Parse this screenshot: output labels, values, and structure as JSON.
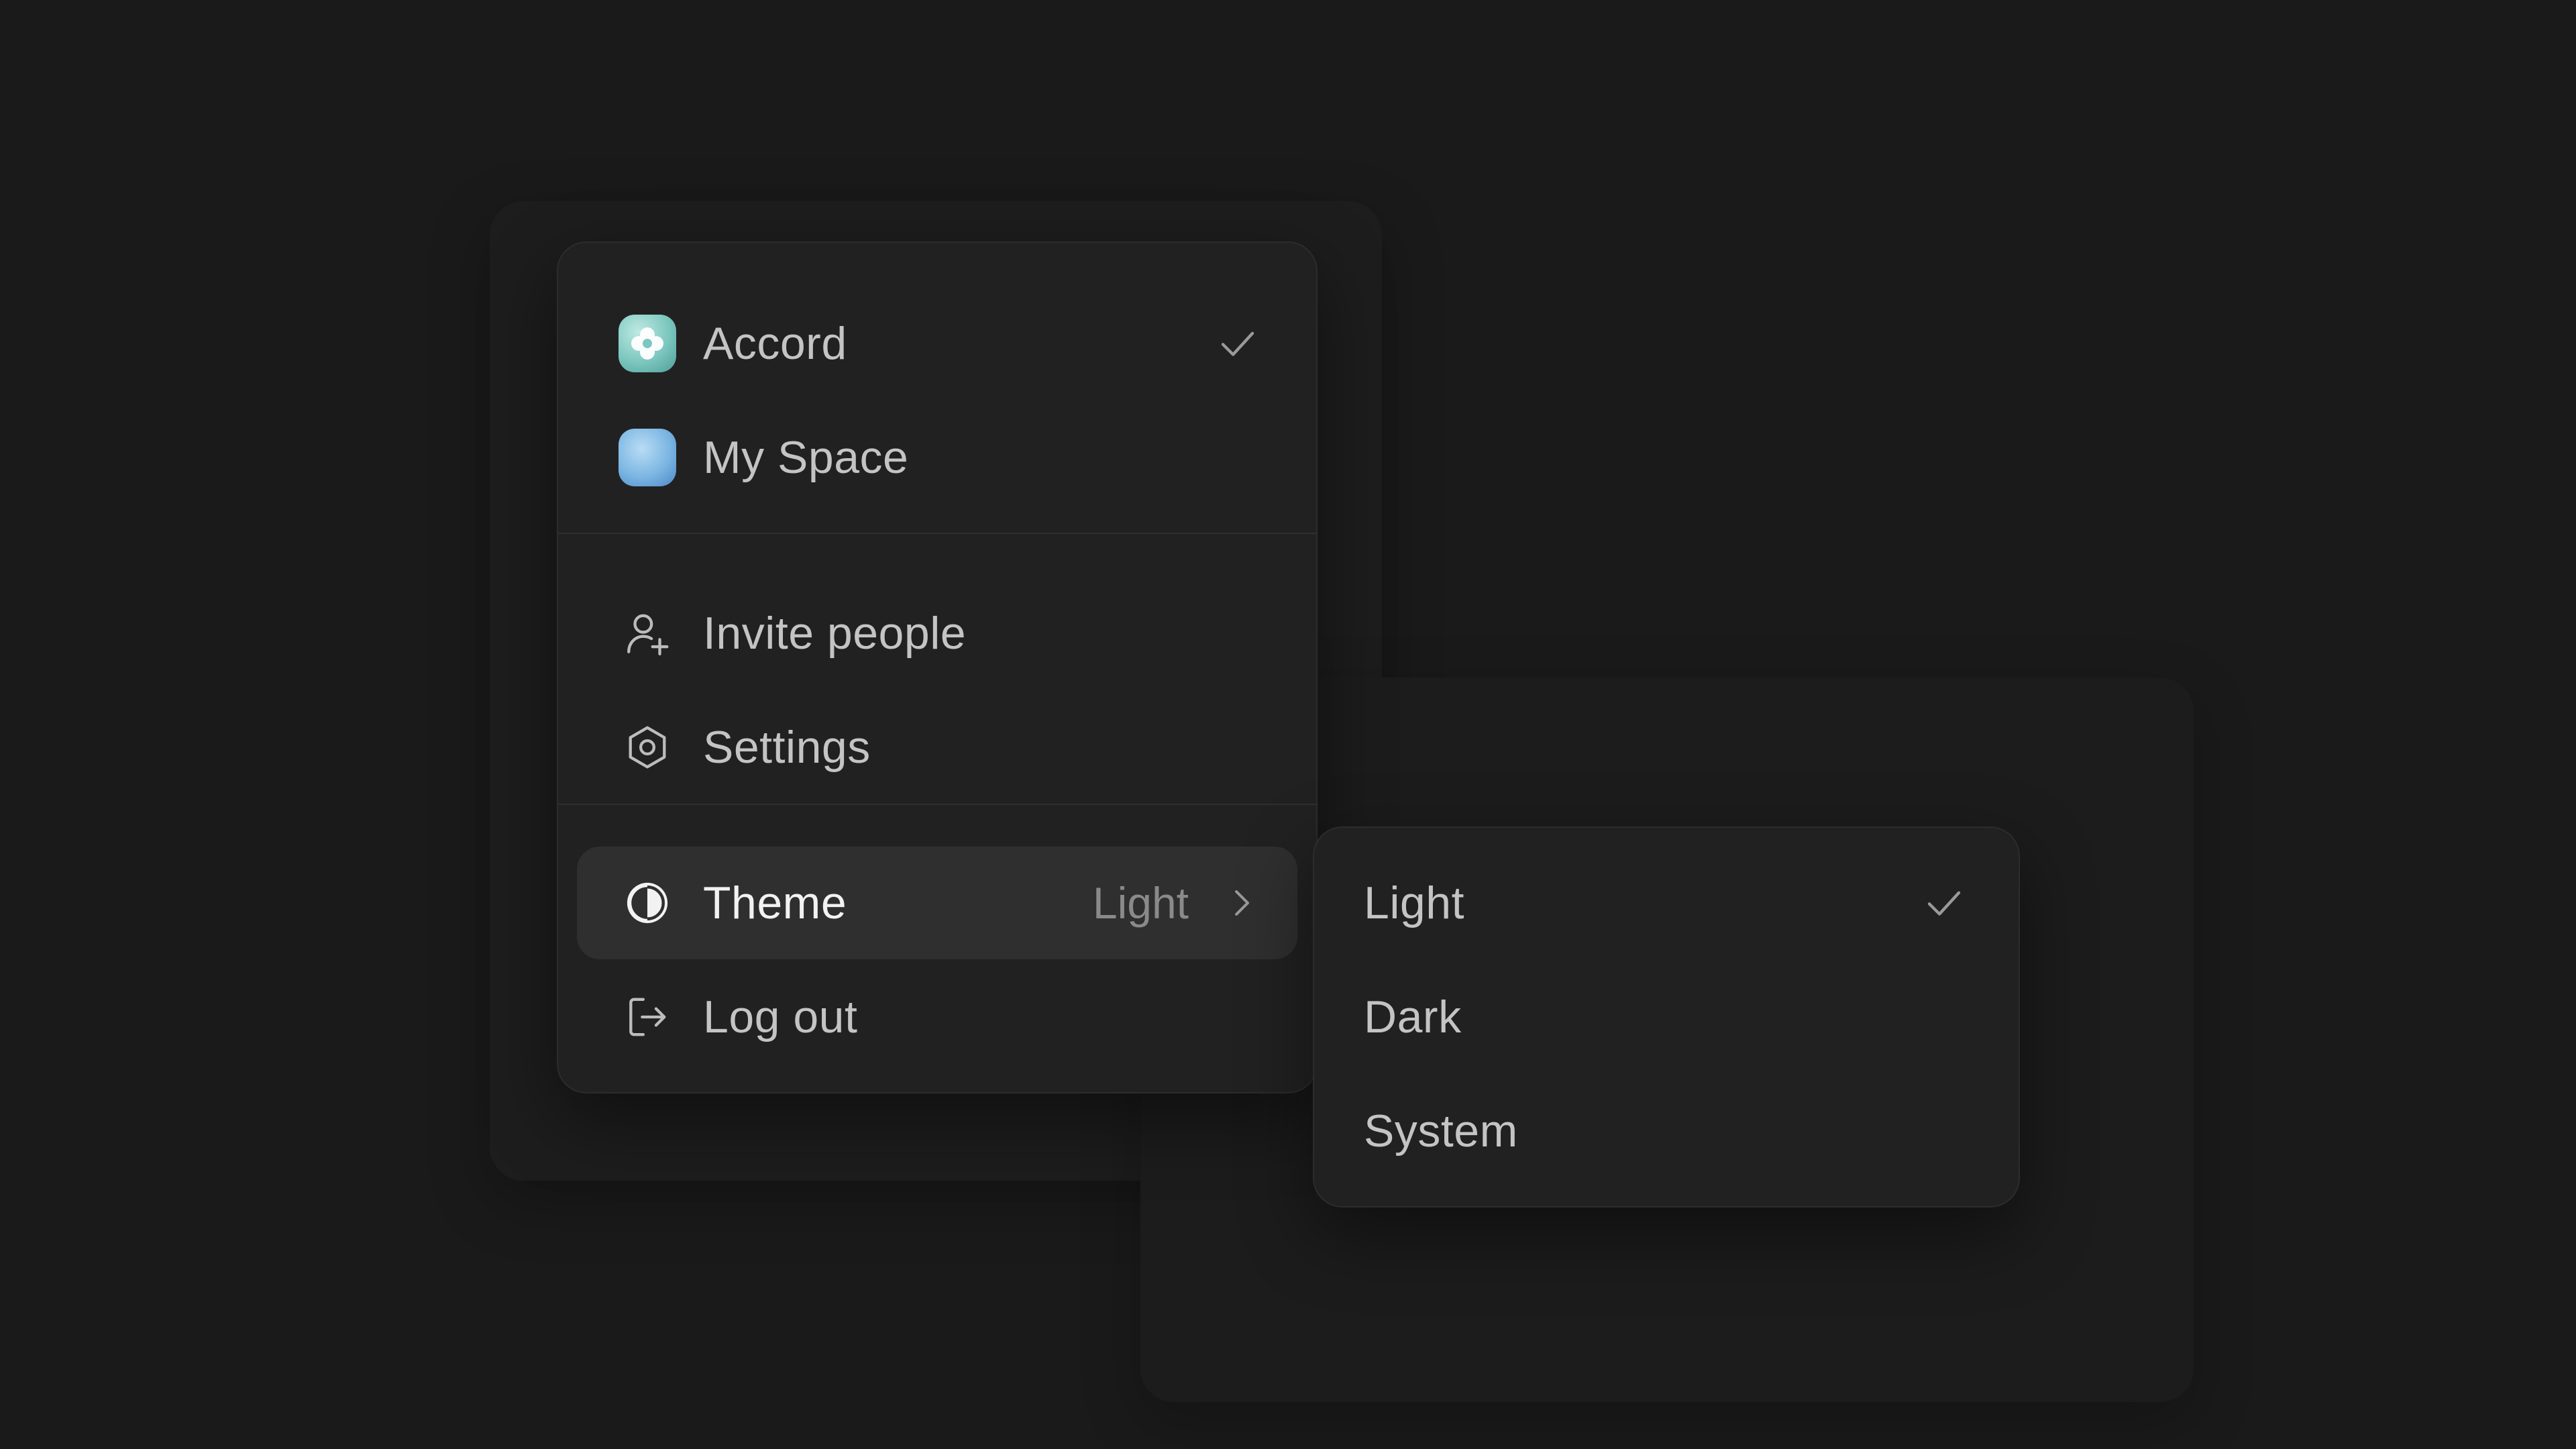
{
  "menu": {
    "workspaces": [
      {
        "label": "Accord",
        "icon": "accord-logo-icon",
        "selected": true
      },
      {
        "label": "My Space",
        "icon": "my-space-avatar-icon",
        "selected": false
      }
    ],
    "actions": [
      {
        "label": "Invite people",
        "icon": "user-plus-icon"
      },
      {
        "label": "Settings",
        "icon": "settings-hexagon-icon"
      }
    ],
    "theme": {
      "label": "Theme",
      "value": "Light",
      "icon": "contrast-icon",
      "chevron": "chevron-right-icon"
    },
    "logout": {
      "label": "Log out",
      "icon": "log-out-icon"
    }
  },
  "theme_submenu": {
    "options": [
      {
        "label": "Light",
        "selected": true
      },
      {
        "label": "Dark",
        "selected": false
      },
      {
        "label": "System",
        "selected": false
      }
    ]
  },
  "colors": {
    "background": "#1a1a1a",
    "panel": "#212121",
    "active_row": "#2f2f2f",
    "text": "#c4c4c4",
    "muted": "#8a8a8a"
  }
}
